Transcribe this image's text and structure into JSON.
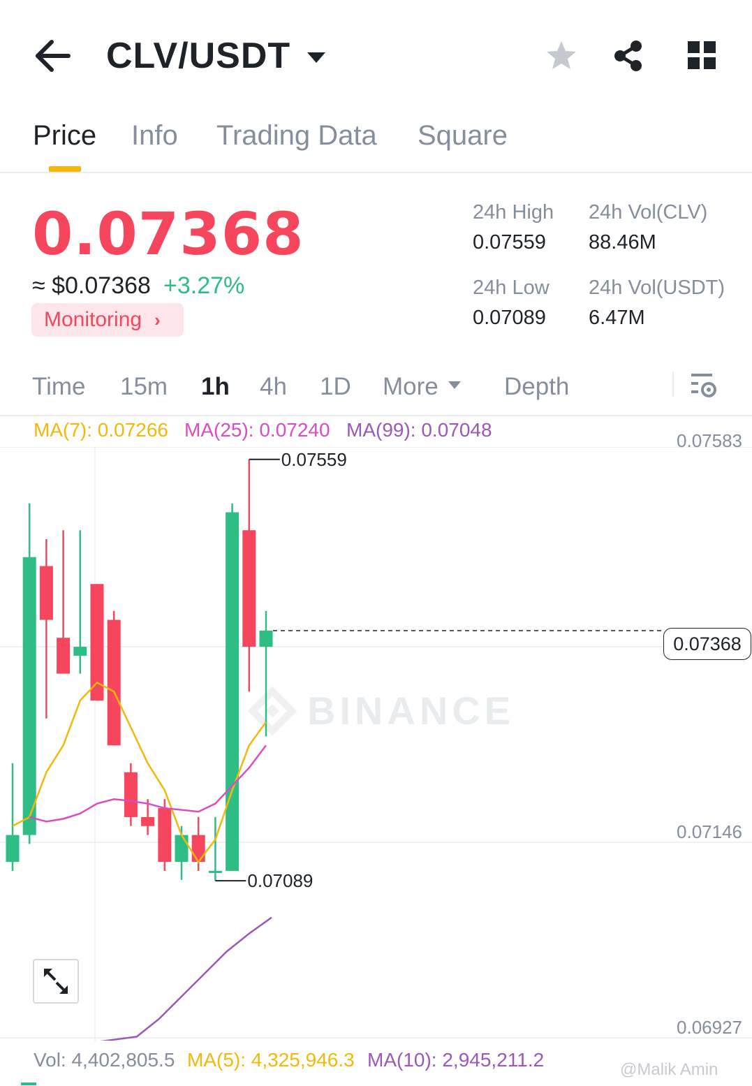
{
  "header": {
    "pair": "CLV/USDT"
  },
  "tabs": [
    {
      "label": "Price",
      "active": true
    },
    {
      "label": "Info",
      "active": false
    },
    {
      "label": "Trading Data",
      "active": false
    },
    {
      "label": "Square",
      "active": false
    }
  ],
  "ticker": {
    "last_price": "0.07368",
    "approx_usd": "≈ $0.07368",
    "change_pct": "+3.27%",
    "monitoring_label": "Monitoring",
    "stats": {
      "high_label": "24h High",
      "high_value": "0.07559",
      "low_label": "24h Low",
      "low_value": "0.07089",
      "vol_base_label": "24h Vol(CLV)",
      "vol_base_value": "88.46M",
      "vol_quote_label": "24h Vol(USDT)",
      "vol_quote_value": "6.47M"
    }
  },
  "intervals": {
    "items": [
      "Time",
      "15m",
      "1h",
      "4h",
      "1D",
      "More",
      "Depth"
    ],
    "active": "1h"
  },
  "indicators": {
    "ma7": "MA(7): 0.07266",
    "ma25": "MA(25): 0.07240",
    "ma99": "MA(99): 0.07048"
  },
  "axis_labels": {
    "top": "0.07583",
    "mid": "0.07146",
    "bottom": "0.06927"
  },
  "chart_annotations": {
    "high_marker": "0.07559",
    "low_marker": "0.07089",
    "current_price": "0.07368",
    "watermark": "BINANCE"
  },
  "volume": {
    "vol": "Vol: 4,402,805.5",
    "ma5": "MA(5): 4,325,946.3",
    "ma10": "MA(10): 2,945,211.2"
  },
  "user_watermark": "@Malik Amin",
  "colors": {
    "up": "#2ebd85",
    "down": "#f6465d",
    "accent": "#f0b90b",
    "ma7": "#f0b90b",
    "ma25": "#d84ec1",
    "ma99": "#9b59b6"
  },
  "icons": [
    "back-arrow-icon",
    "caret-down-icon",
    "star-icon",
    "share-icon",
    "grid-menu-icon",
    "chart-settings-icon",
    "expand-icon",
    "binance-logo-icon"
  ],
  "chart_data": {
    "type": "candlestick",
    "interval": "1h",
    "candles": [
      {
        "open": 0.0711,
        "high": 0.0722,
        "low": 0.071,
        "close": 0.0714
      },
      {
        "open": 0.0714,
        "high": 0.0751,
        "low": 0.0713,
        "close": 0.0745
      },
      {
        "open": 0.0744,
        "high": 0.0747,
        "low": 0.0727,
        "close": 0.0738
      },
      {
        "open": 0.0736,
        "high": 0.0748,
        "low": 0.0732,
        "close": 0.0732
      },
      {
        "open": 0.0734,
        "high": 0.0748,
        "low": 0.0732,
        "close": 0.0735
      },
      {
        "open": 0.0742,
        "high": 0.0742,
        "low": 0.0729,
        "close": 0.0729
      },
      {
        "open": 0.0738,
        "high": 0.0739,
        "low": 0.0724,
        "close": 0.0724
      },
      {
        "open": 0.0721,
        "high": 0.0722,
        "low": 0.0715,
        "close": 0.0716
      },
      {
        "open": 0.0716,
        "high": 0.0718,
        "low": 0.0714,
        "close": 0.0715
      },
      {
        "open": 0.0717,
        "high": 0.0718,
        "low": 0.071,
        "close": 0.0711
      },
      {
        "open": 0.0711,
        "high": 0.0715,
        "low": 0.0709,
        "close": 0.0714
      },
      {
        "open": 0.0714,
        "high": 0.0716,
        "low": 0.071,
        "close": 0.0711
      },
      {
        "open": 0.071,
        "high": 0.0716,
        "low": 0.07089,
        "close": 0.071
      },
      {
        "open": 0.071,
        "high": 0.0751,
        "low": 0.071,
        "close": 0.075
      },
      {
        "open": 0.0748,
        "high": 0.07559,
        "low": 0.073,
        "close": 0.0735
      },
      {
        "open": 0.0735,
        "high": 0.0739,
        "low": 0.0725,
        "close": 0.07368
      }
    ],
    "ma7": [
      0.0715,
      0.0716,
      0.0721,
      0.0724,
      0.0729,
      0.0731,
      0.073,
      0.0726,
      0.0722,
      0.0719,
      0.0714,
      0.0711,
      0.07135,
      0.0719,
      0.0724,
      0.07266
    ],
    "ma25": [
      0.0716,
      0.07155,
      0.07158,
      0.07164,
      0.07175,
      0.0718,
      0.07178,
      0.07175,
      0.0717,
      0.07168,
      0.07166,
      0.07175,
      0.07195,
      0.07215,
      0.0724
    ],
    "ma99": [
      0.06915,
      0.06935,
      0.0696,
      0.06985,
      0.0701,
      0.0703,
      0.07048
    ],
    "ylim": [
      0.06927,
      0.07583
    ]
  }
}
